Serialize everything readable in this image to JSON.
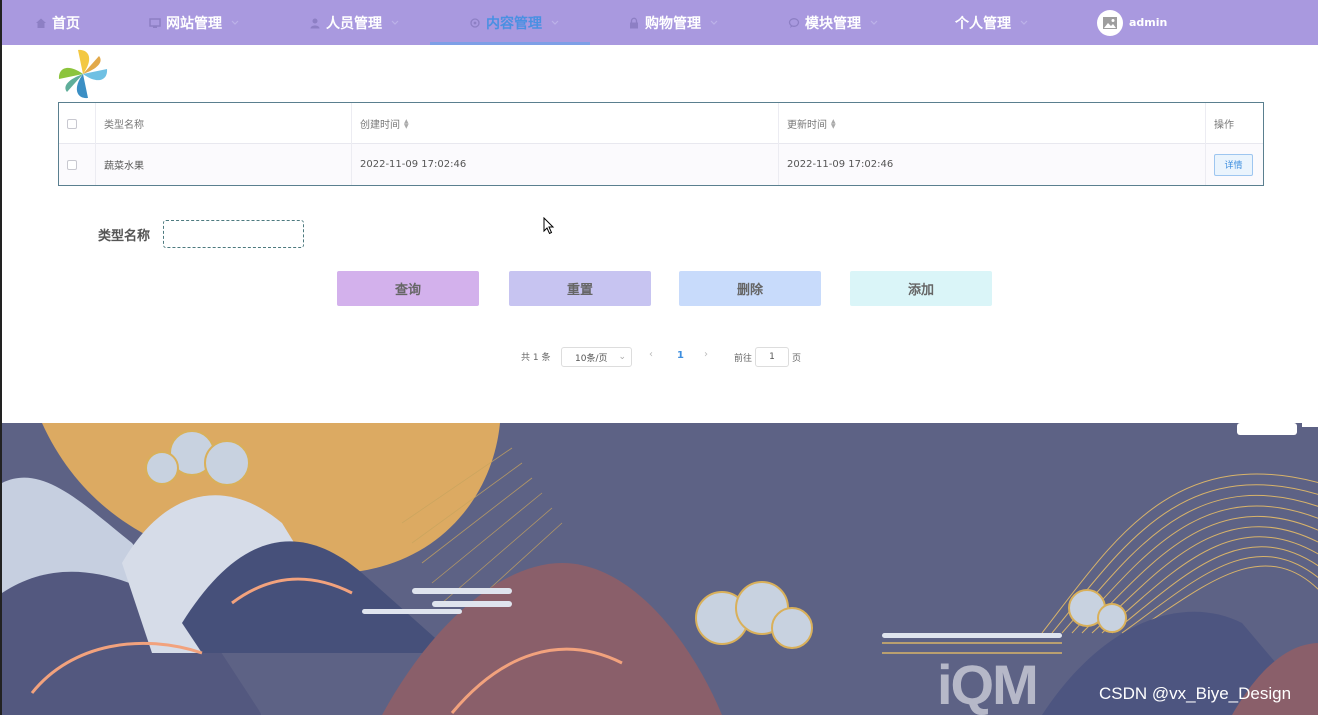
{
  "nav": {
    "items": [
      {
        "label": "首页",
        "icon": "home-icon",
        "has_caret": false,
        "active": false
      },
      {
        "label": "网站管理",
        "icon": "monitor-icon",
        "has_caret": true,
        "active": false
      },
      {
        "label": "人员管理",
        "icon": "user-icon",
        "has_caret": true,
        "active": false
      },
      {
        "label": "内容管理",
        "icon": "gear-icon",
        "has_caret": true,
        "active": true
      },
      {
        "label": "购物管理",
        "icon": "lock-icon",
        "has_caret": true,
        "active": false
      },
      {
        "label": "模块管理",
        "icon": "chat-icon",
        "has_caret": true,
        "active": false
      },
      {
        "label": "个人管理",
        "icon": "",
        "has_caret": true,
        "active": false
      }
    ],
    "user": {
      "name": "admin",
      "avatar_icon": "image-icon"
    },
    "colors": {
      "bar": "#a999df",
      "active_text": "#4a90e2"
    }
  },
  "table": {
    "columns": [
      {
        "label": "",
        "type": "checkbox"
      },
      {
        "label": "类型名称",
        "sortable": false
      },
      {
        "label": "创建时间",
        "sortable": true
      },
      {
        "label": "更新时间",
        "sortable": true
      },
      {
        "label": "操作",
        "sortable": false
      }
    ],
    "rows": [
      {
        "name": "蔬菜水果",
        "created": "2022-11-09 17:02:46",
        "updated": "2022-11-09 17:02:46",
        "action": "详情"
      }
    ]
  },
  "search": {
    "label": "类型名称",
    "value": "",
    "placeholder": ""
  },
  "buttons": {
    "query": "查询",
    "reset": "重置",
    "delete": "删除",
    "add": "添加"
  },
  "pagination": {
    "total_text": "共 1 条",
    "page_size": "10条/页",
    "current_page": "1",
    "goto_label": "前往",
    "goto_value": "1",
    "page_unit": "页"
  },
  "watermark": {
    "text": "CSDN @vx_Biye_Design",
    "logo": "iQM"
  }
}
